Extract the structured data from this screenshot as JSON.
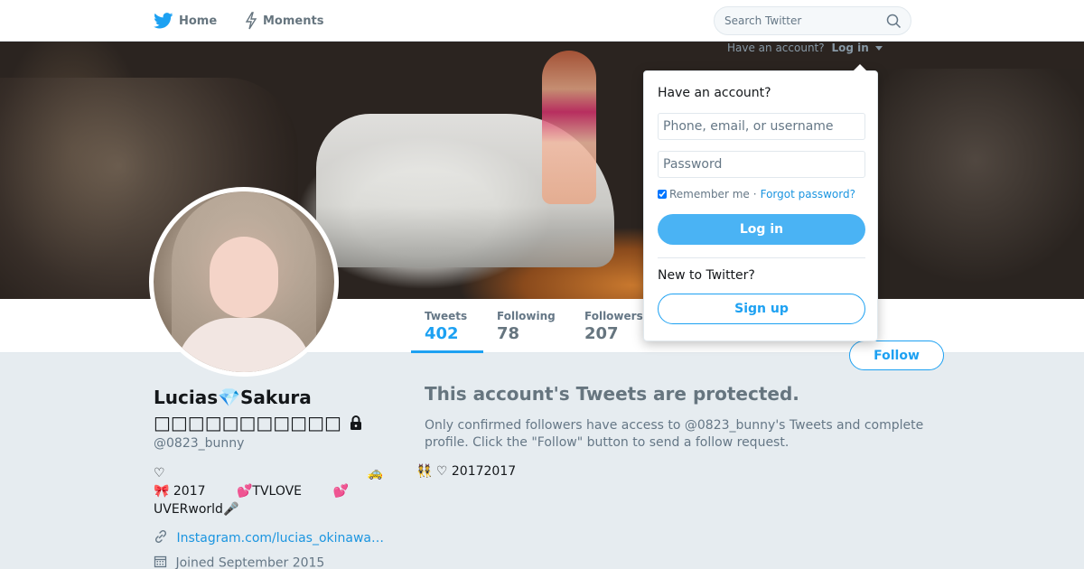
{
  "nav": {
    "home_label": "Home",
    "moments_label": "Moments",
    "search_placeholder": "Search Twitter",
    "have_account_text": "Have an account?",
    "login_link": "Log in",
    "accent_color": "#1da1f2"
  },
  "stats": {
    "tweets_label": "Tweets",
    "tweets_value": "402",
    "following_label": "Following",
    "following_value": "78",
    "followers_label": "Followers",
    "followers_value": "207"
  },
  "follow_button": "Follow",
  "profile": {
    "name": "Lucias💎Sakura □□□□□□□□□□□",
    "screen_name": "@0823_bunny",
    "bio_line1": "♡",
    "bio_line1_emoji": "🚕",
    "bio_line2_a": "🎀 2017",
    "bio_line2_b": "💕TVLOVE",
    "bio_line2_c": "💕",
    "bio_line3": "UVERworld🎤",
    "url": "Instagram.com/lucias_okinawa…",
    "joined": "Joined September 2015"
  },
  "protected": {
    "title": "This account's Tweets are protected.",
    "body": "Only confirmed followers have access to @0823_bunny's Tweets and complete profile. Click the \"Follow\" button to send a follow request.",
    "snippet": "👯 ♡ 20172017"
  },
  "login_dropdown": {
    "heading": "Have an account?",
    "username_placeholder": "Phone, email, or username",
    "password_placeholder": "Password",
    "remember_label": "Remember me",
    "separator": "·",
    "forgot_label": "Forgot password?",
    "login_button": "Log in",
    "new_heading": "New to Twitter?",
    "signup_button": "Sign up"
  }
}
